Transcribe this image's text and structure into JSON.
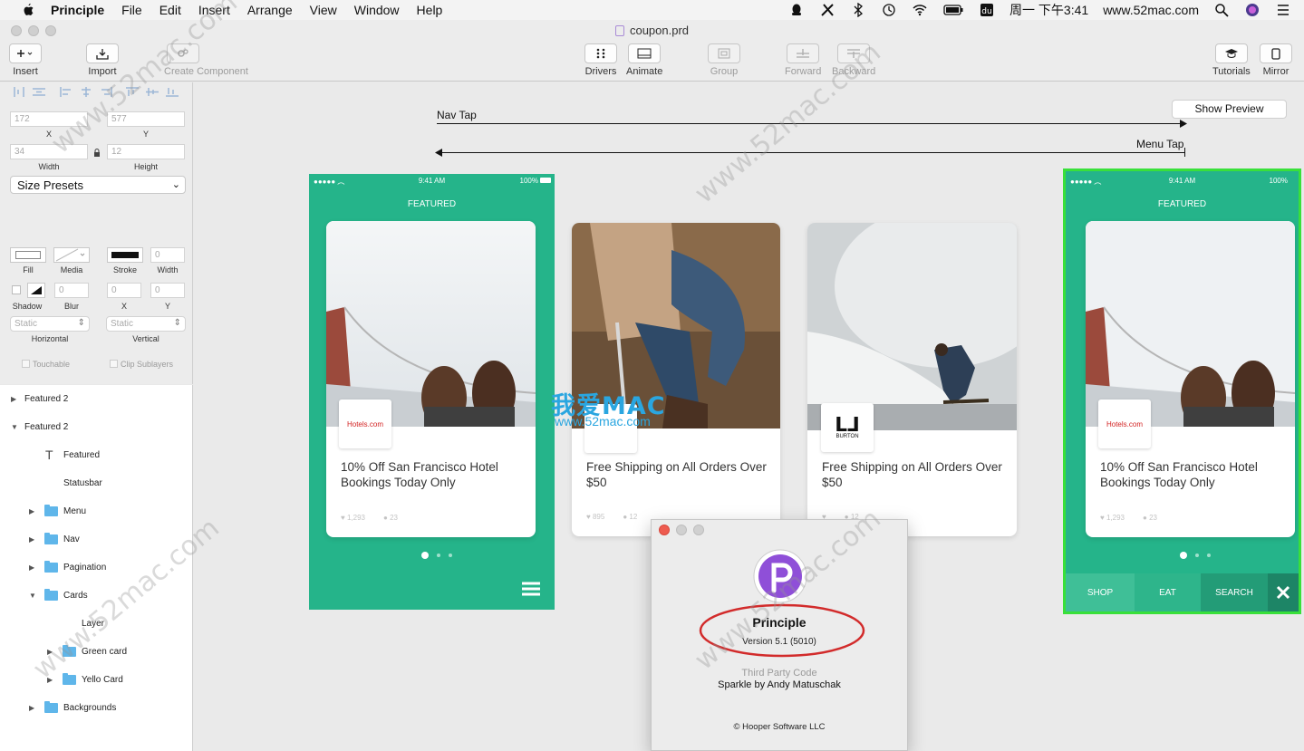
{
  "menubar": {
    "app_name": "Principle",
    "items": [
      "File",
      "Edit",
      "Insert",
      "Arrange",
      "View",
      "Window",
      "Help"
    ],
    "clock": "周一 下午3:41",
    "site": "www.52mac.com"
  },
  "window": {
    "title": "coupon.prd"
  },
  "toolbar": {
    "insert": "Insert",
    "import": "Import",
    "create_component": "Create Component",
    "drivers": "Drivers",
    "animate": "Animate",
    "group": "Group",
    "forward": "Forward",
    "backward": "Backward",
    "tutorials": "Tutorials",
    "mirror": "Mirror"
  },
  "inspector": {
    "x_value": "172",
    "x_label": "X",
    "y_value": "577",
    "y_label": "Y",
    "width_value": "34",
    "width_label": "Width",
    "height_value": "12",
    "height_label": "Height",
    "size_presets": "Size Presets",
    "fill_label": "Fill",
    "media_label": "Media",
    "stroke_label": "Stroke",
    "stroke_width_value": "0",
    "stroke_width_label": "Width",
    "shadow_label": "Shadow",
    "blur_value": "0",
    "blur_label": "Blur",
    "shadow_x_value": "0",
    "shadow_x_label": "X",
    "shadow_y_value": "0",
    "shadow_y_label": "Y",
    "horizontal_value": "Static",
    "horizontal_label": "Horizontal",
    "vertical_value": "Static",
    "vertical_label": "Vertical",
    "touchable_label": "Touchable",
    "clip_label": "Clip Sublayers"
  },
  "layers": [
    {
      "label": "Featured 2",
      "type": "group",
      "expanded": false
    },
    {
      "label": "Featured 2",
      "type": "group",
      "expanded": true
    },
    {
      "label": "Featured",
      "type": "text"
    },
    {
      "label": "Statusbar",
      "type": "layer"
    },
    {
      "label": "Menu",
      "type": "folder"
    },
    {
      "label": "Nav",
      "type": "folder"
    },
    {
      "label": "Pagination",
      "type": "folder"
    },
    {
      "label": "Cards",
      "type": "folder",
      "expanded": true
    },
    {
      "label": "Layer",
      "type": "layer"
    },
    {
      "label": "Green card",
      "type": "folder"
    },
    {
      "label": "Yello Card",
      "type": "folder"
    },
    {
      "label": "Backgrounds",
      "type": "folder"
    }
  ],
  "canvas": {
    "nav_tap": "Nav Tap",
    "menu_tap": "Menu Tap",
    "show_preview": "Show Preview",
    "status_time": "9:41 AM",
    "status_battery": "100%",
    "featured": "FEATURED",
    "card1_title": "10% Off San Francisco Hotel Bookings Today Only",
    "card1_logo": "Hotels.com",
    "card1_likes": "1,293",
    "card1_comments": "23",
    "card2_title": "Free Shipping on All Orders Over $50",
    "card2_likes": "895",
    "card2_comments": "12",
    "card3_title": "Free Shipping on All Orders Over $50",
    "card3_logo": "BURTON",
    "card3_comments": "12",
    "tabs": [
      "SHOP",
      "EAT",
      "SEARCH"
    ],
    "watermark_brand": "我爱MAC",
    "watermark_site": "www.52mac.com"
  },
  "about": {
    "app_name": "Principle",
    "version": "Version 5.1 (5010)",
    "third_party": "Third Party Code",
    "sparkle": "Sparkle by Andy Matuschak",
    "copyright": "© Hooper Software LLC"
  },
  "colors": {
    "accent_green": "#25b48a",
    "selection_green": "#39e03a",
    "dialog_close": "#ee5b4f",
    "annotation_red": "#d22b2b"
  }
}
